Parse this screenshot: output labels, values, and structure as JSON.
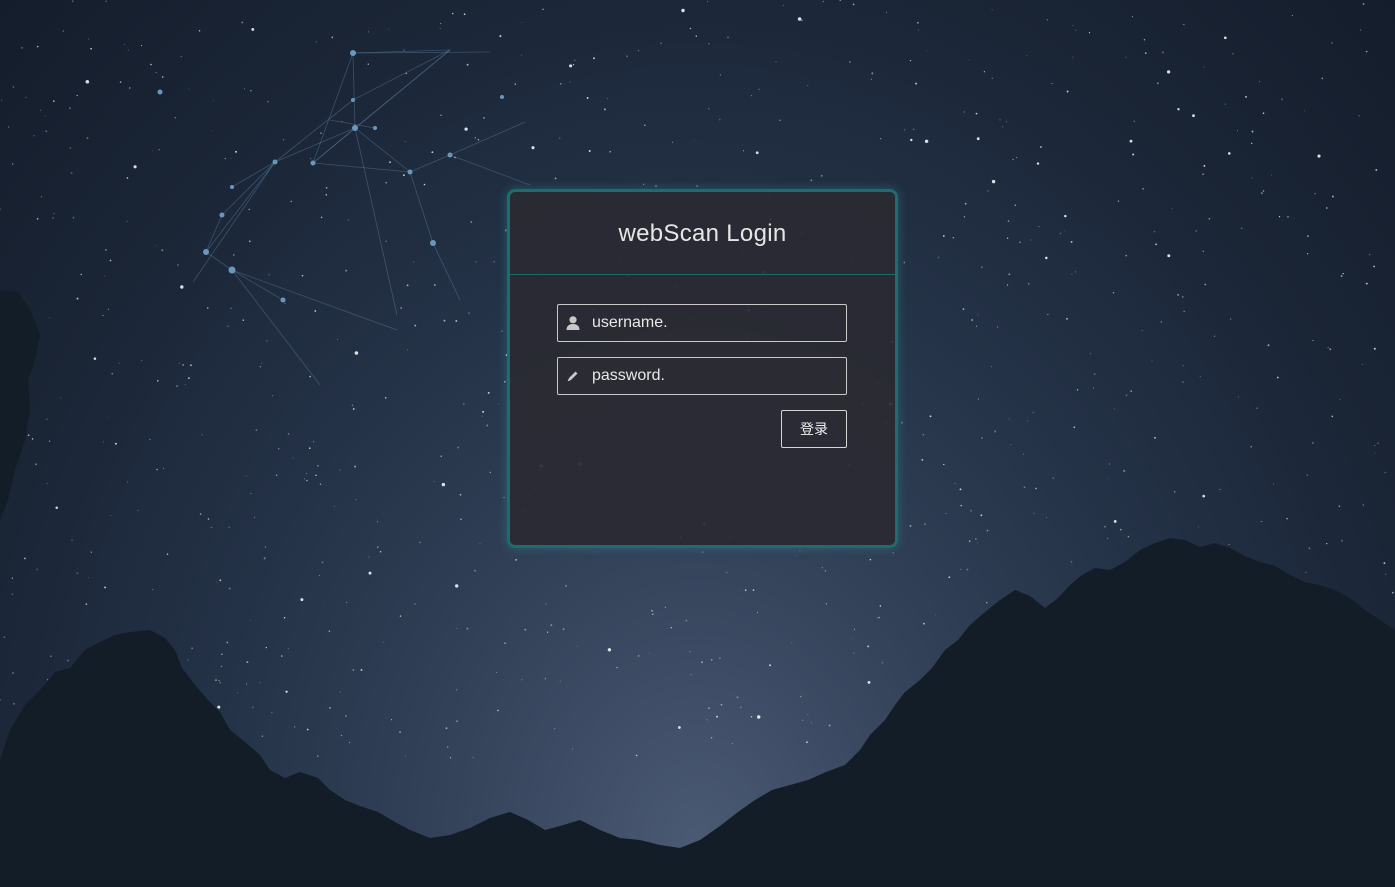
{
  "login": {
    "title": "webScan Login",
    "username_placeholder": "username.",
    "password_placeholder": "password.",
    "submit_label": "登录"
  },
  "icons": {
    "username": "user-icon",
    "password": "pencil-icon"
  },
  "colors": {
    "accent": "#1f6b6e",
    "panel": "#2a2a32",
    "text": "#e6e6e6"
  }
}
